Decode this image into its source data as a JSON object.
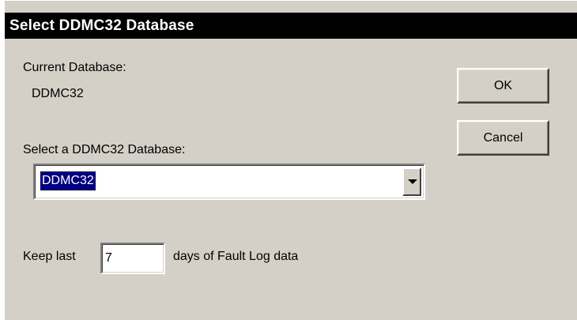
{
  "window": {
    "title": "Select DDMC32 Database"
  },
  "current_database": {
    "label": "Current Database:",
    "value": "DDMC32"
  },
  "buttons": {
    "ok_label": "OK",
    "cancel_label": "Cancel"
  },
  "select_database": {
    "label": "Select a DDMC32 Database:",
    "selected_value": "DDMC32",
    "arrow_icon": "chevron-down-icon"
  },
  "fault_log": {
    "prefix_label": "Keep last",
    "days_value": "7",
    "suffix_label": "days of Fault Log data"
  }
}
